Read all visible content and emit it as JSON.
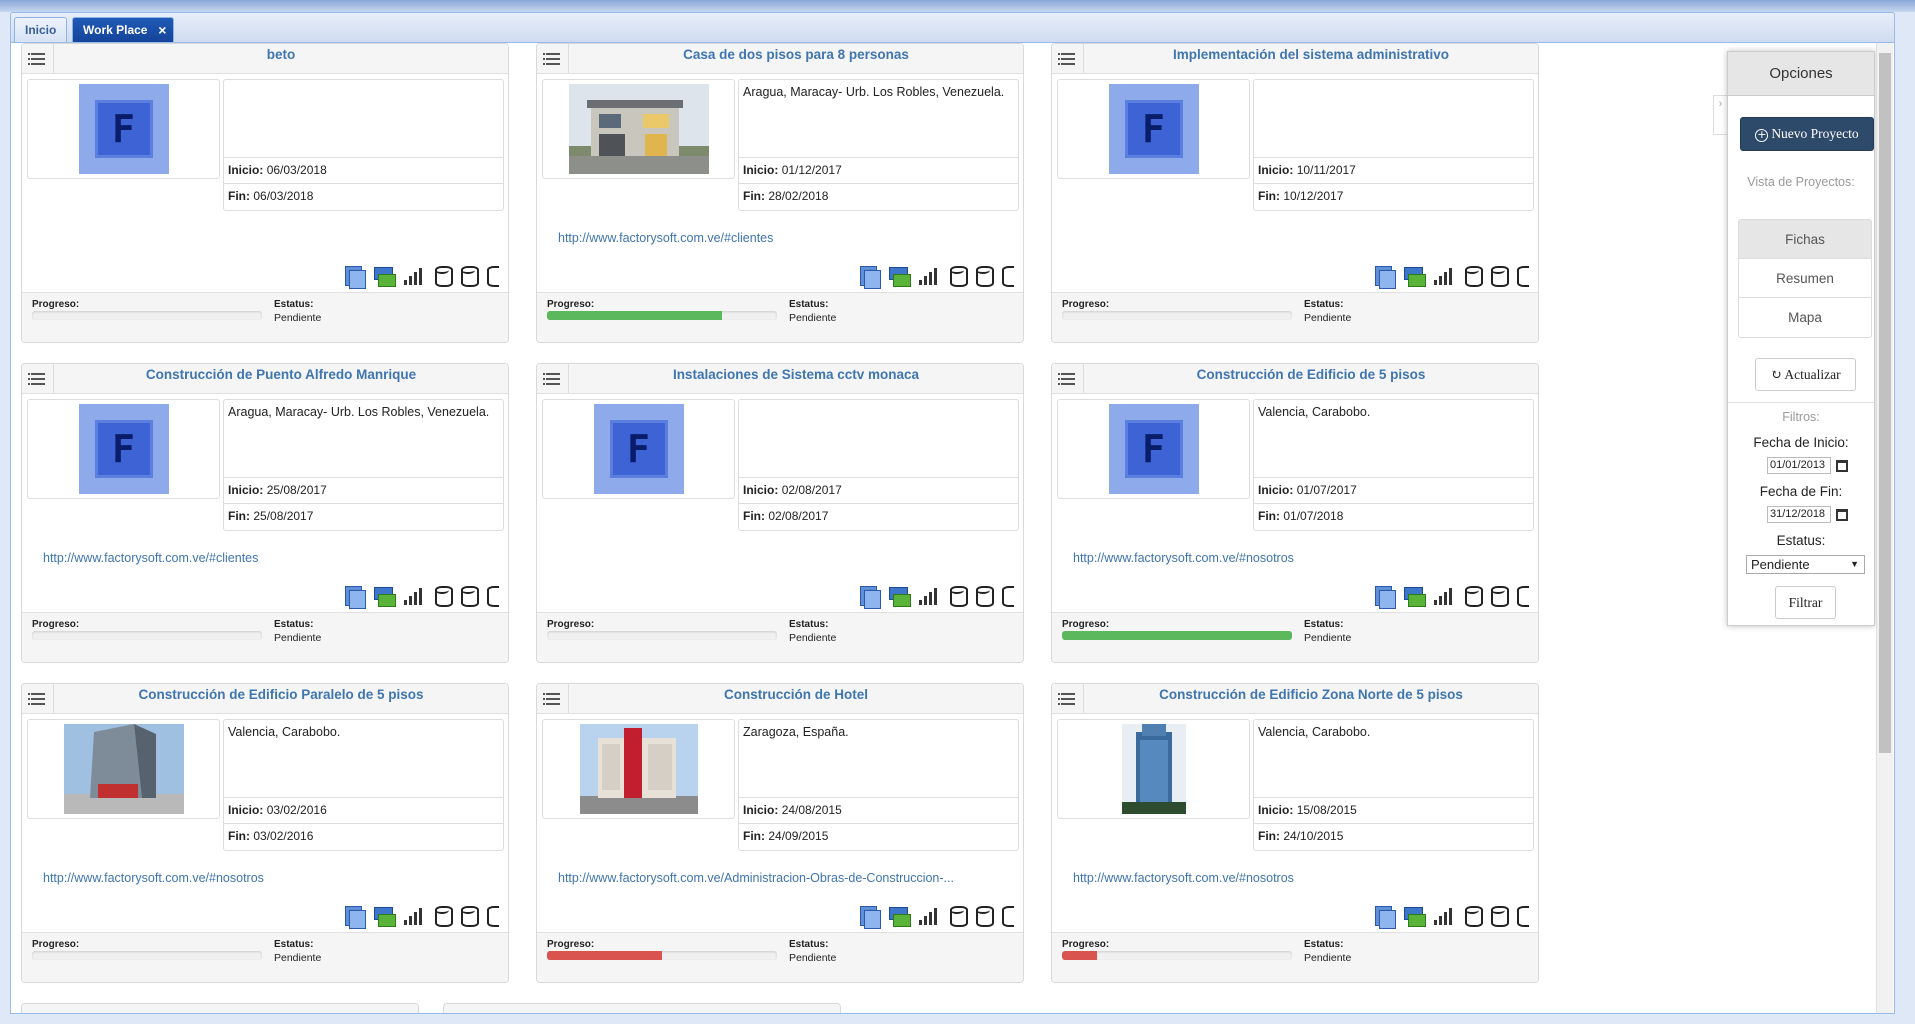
{
  "tabs": {
    "inicio": "Inicio",
    "work_place": "Work Place",
    "close": "×"
  },
  "labels": {
    "inicio": "Inicio:",
    "fin": "Fin:",
    "progreso": "Progreso:",
    "estatus": "Estatus:"
  },
  "colors": {
    "accent": "#2e4a6b",
    "link": "#3f75b0",
    "progress_green": "#5cb85c",
    "progress_red": "#d9534f"
  },
  "projects": [
    {
      "title": "beto",
      "image": "logo-icon",
      "address": "",
      "inicio": "06/03/2018",
      "fin": "06/03/2018",
      "link": "",
      "progress": 0,
      "progress_color": "#5cb85c",
      "status": "Pendiente"
    },
    {
      "title": "Casa de dos pisos para 8 personas",
      "image": "house-photo",
      "address": "Aragua, Maracay- Urb. Los Robles, Venezuela.",
      "inicio": "01/12/2017",
      "fin": "28/02/2018",
      "link": "http://www.factorysoft.com.ve/#clientes",
      "progress": 0.76,
      "progress_color": "#5cb85c",
      "status": "Pendiente"
    },
    {
      "title": "Implementación del sistema administrativo",
      "image": "logo-icon",
      "address": "",
      "inicio": "10/11/2017",
      "fin": "10/12/2017",
      "link": "",
      "progress": 0,
      "progress_color": "#5cb85c",
      "status": "Pendiente"
    },
    {
      "title": "Construcción de Puento Alfredo Manrique",
      "image": "logo-icon",
      "address": "Aragua, Maracay- Urb. Los Robles, Venezuela.",
      "inicio": "25/08/2017",
      "fin": "25/08/2017",
      "link": "http://www.factorysoft.com.ve/#clientes",
      "progress": 0,
      "progress_color": "#5cb85c",
      "status": "Pendiente"
    },
    {
      "title": "Instalaciones de Sistema cctv monaca",
      "image": "logo-icon",
      "address": "",
      "inicio": "02/08/2017",
      "fin": "02/08/2017",
      "link": "",
      "progress": 0,
      "progress_color": "#5cb85c",
      "status": "Pendiente"
    },
    {
      "title": "Construcción de Edificio de 5 pisos",
      "image": "logo-icon",
      "address": "Valencia, Carabobo.",
      "inicio": "01/07/2017",
      "fin": "01/07/2018",
      "link": "http://www.factorysoft.com.ve/#nosotros",
      "progress": 1,
      "progress_color": "#5cb85c",
      "status": "Pendiente"
    },
    {
      "title": "Construcción de Edificio Paralelo de 5 pisos",
      "image": "building-photo",
      "address": "Valencia, Carabobo.",
      "inicio": "03/02/2016",
      "fin": "03/02/2016",
      "link": "http://www.factorysoft.com.ve/#nosotros",
      "progress": 0,
      "progress_color": "#5cb85c",
      "status": "Pendiente"
    },
    {
      "title": "Construcción de Hotel",
      "image": "hotel-photo",
      "address": "Zaragoza, España.",
      "inicio": "24/08/2015",
      "fin": "24/09/2015",
      "link": "http://www.factorysoft.com.ve/Administracion-Obras-de-Construccion-...",
      "progress": 0.5,
      "progress_color": "#d9534f",
      "status": "Pendiente"
    },
    {
      "title": "Construcción de Edificio Zona Norte de 5 pisos",
      "image": "tower-photo",
      "address": "Valencia, Carabobo.",
      "inicio": "15/08/2015",
      "fin": "24/10/2015",
      "link": "http://www.factorysoft.com.ve/#nosotros",
      "progress": 0.15,
      "progress_color": "#d9534f",
      "status": "Pendiente"
    }
  ],
  "options": {
    "title": "Opciones",
    "new_project": "Nuevo Proyecto",
    "vista_label": "Vista de Proyectos:",
    "views": [
      "Fichas",
      "Resumen",
      "Mapa"
    ],
    "refresh": "Actualizar",
    "filtros_label": "Filtros:",
    "fecha_inicio_label": "Fecha de Inicio:",
    "fecha_inicio": "01/01/2013",
    "fecha_fin_label": "Fecha de Fin:",
    "fecha_fin": "31/12/2018",
    "estatus_label": "Estatus:",
    "estatus_value": "Pendiente",
    "filter_button": "Filtrar"
  }
}
